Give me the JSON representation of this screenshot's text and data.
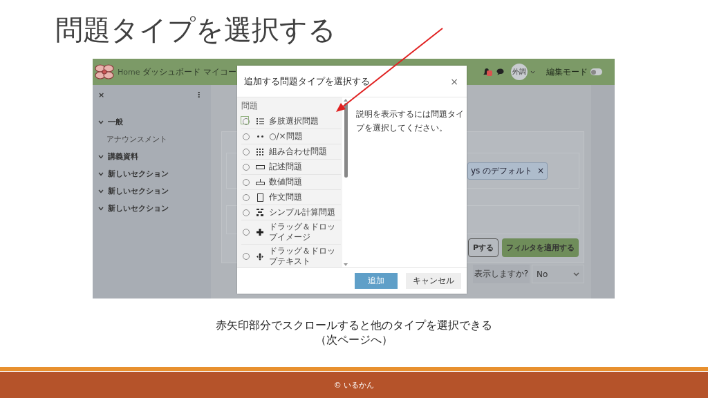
{
  "slide": {
    "title": "問題タイプを選択する",
    "caption": [
      "赤矢印部分でスクロールすると他のタイプを選択できる",
      "（次ページへ）"
    ],
    "footer": "© いるかん"
  },
  "app": {
    "nav": [
      {
        "label": "Home"
      },
      {
        "label": "ダッシュボード"
      },
      {
        "label": "マイコー"
      }
    ],
    "avatar": "外調",
    "edit_mode": {
      "label": "編集モード",
      "on": false
    }
  },
  "sidebar": {
    "close": "×",
    "menu": "⋮",
    "sections": [
      {
        "title": "一般",
        "expanded": true,
        "children": [
          {
            "label": "アナウンスメント"
          }
        ]
      },
      {
        "title": "講義資料",
        "expanded": true
      },
      {
        "title": "新しいセクション",
        "expanded": true
      },
      {
        "title": "新しいセクション",
        "expanded": true
      },
      {
        "title": "新しいセクション",
        "expanded": true
      }
    ]
  },
  "background": {
    "filter_tag": "ys のデフォルト",
    "tag_remove": "×",
    "buttons": [
      {
        "label": "Pする",
        "kind": "outline"
      },
      {
        "label": "フィルタを適用する",
        "kind": "primary"
      }
    ],
    "select_label": "表示しますか?",
    "select_value": "No"
  },
  "dialog": {
    "title": "追加する問題タイプを選択する",
    "close": "×",
    "group_heading": "問題",
    "options": [
      {
        "label": "多肢選択問題",
        "selected": false,
        "focused": true
      },
      {
        "label": "○/×問題",
        "selected": false,
        "focused": false
      },
      {
        "label": "組み合わせ問題",
        "selected": false,
        "focused": false
      },
      {
        "label": "記述問題",
        "selected": false,
        "focused": false
      },
      {
        "label": "数値問題",
        "selected": false,
        "focused": false
      },
      {
        "label": "作文問題",
        "selected": false,
        "focused": false
      },
      {
        "label": "シンプル計算問題",
        "selected": false,
        "focused": false
      },
      {
        "label": "ドラッグ＆ドロップイメージ",
        "selected": false,
        "focused": false
      },
      {
        "label": "ドラッグ＆ドロップテキスト",
        "selected": false,
        "focused": false
      }
    ],
    "description": "説明を表示するには問題タイプを選択してください。",
    "buttons": [
      {
        "label": "追加",
        "kind": "primary"
      },
      {
        "label": "キャンセル",
        "kind": "secondary"
      }
    ]
  }
}
